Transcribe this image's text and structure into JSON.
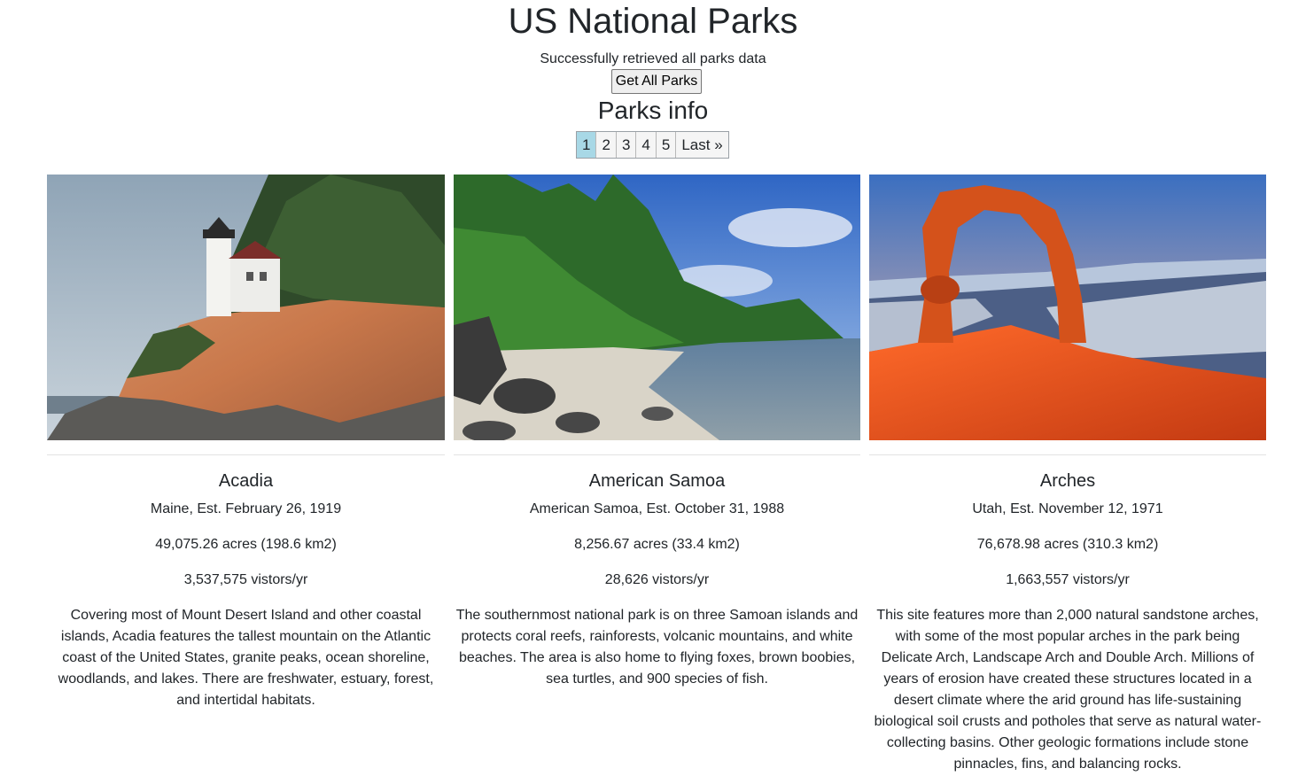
{
  "header": {
    "title": "US National Parks",
    "status": "Successfully retrieved all parks data",
    "get_button": "Get All Parks",
    "section_title": "Parks info"
  },
  "pagination": {
    "pages": [
      "1",
      "2",
      "3",
      "4",
      "5"
    ],
    "last_label": "Last »",
    "active_page": "1",
    "active_color": "#a8d8e6"
  },
  "parks": [
    {
      "name": "Acadia",
      "established": "Maine, Est. February 26, 1919",
      "area": "49,075.26 acres (198.6 km2)",
      "visitors": "3,537,575 vistors/yr",
      "description": "Covering most of Mount Desert Island and other coastal islands, Acadia features the tallest mountain on the Atlantic coast of the United States, granite peaks, ocean shoreline, woodlands, and lakes. There are freshwater, estuary, forest, and intertidal habitats."
    },
    {
      "name": "American Samoa",
      "established": "American Samoa, Est. October 31, 1988",
      "area": "8,256.67 acres (33.4 km2)",
      "visitors": "28,626 vistors/yr",
      "description": "The southernmost national park is on three Samoan islands and protects coral reefs, rainforests, volcanic mountains, and white beaches. The area is also home to flying foxes, brown boobies, sea turtles, and 900 species of fish."
    },
    {
      "name": "Arches",
      "established": "Utah, Est. November 12, 1971",
      "area": "76,678.98 acres (310.3 km2)",
      "visitors": "1,663,557 vistors/yr",
      "description": "This site features more than 2,000 natural sandstone arches, with some of the most popular arches in the park being Delicate Arch, Landscape Arch and Double Arch. Millions of years of erosion have created these structures located in a desert climate where the arid ground has life-sustaining biological soil crusts and potholes that serve as natural water-collecting basins. Other geologic formations include stone pinnacles, fins, and balancing rocks."
    }
  ]
}
